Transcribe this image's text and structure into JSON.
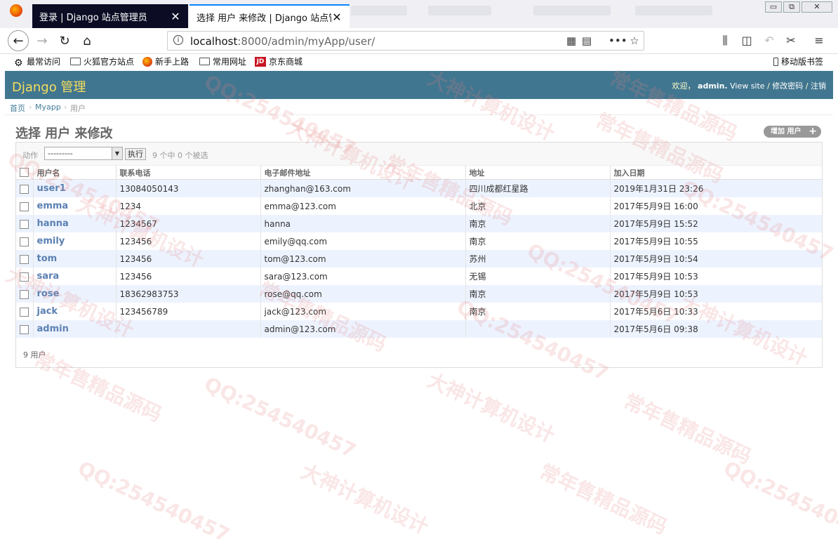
{
  "browser": {
    "tabs": [
      {
        "title": "登录 | Django 站点管理员",
        "close": "✕"
      },
      {
        "title": "选择 用户 来修改 | Django 站点管",
        "close": "✕"
      }
    ],
    "url_host": "localhost",
    "url_rest": ":8000/admin/myApp/user/",
    "bookmarks": [
      "最常访问",
      "火狐官方站点",
      "新手上路",
      "常用网址",
      "京东商城"
    ],
    "mobile_bookmarks": "移动版书签",
    "window_controls": [
      "▭",
      "⧉",
      "✕"
    ]
  },
  "header": {
    "brand": "Django 管理",
    "welcome": "欢迎，",
    "user": "admin.",
    "view_site": "View site",
    "sep": "/",
    "change_password": "修改密码",
    "logout": "注销"
  },
  "breadcrumbs": [
    "首页",
    "Myapp",
    "用户"
  ],
  "breadcrumb_sep": "›",
  "title": "选择 用户 来修改",
  "add_button": "增加 用户",
  "actions": {
    "label": "动作",
    "select_value": "---------",
    "go": "执行",
    "count": "9 个中 0 个被选"
  },
  "table": {
    "columns": [
      "用户名",
      "联系电话",
      "电子邮件地址",
      "地址",
      "加入日期"
    ],
    "rows": [
      [
        "user1",
        "13084050143",
        "zhanghan@163.com",
        "四川成都红星路",
        "2019年1月31日 23:26"
      ],
      [
        "emma",
        "1234",
        "emma@123.com",
        "北京",
        "2017年5月9日 16:00"
      ],
      [
        "hanna",
        "1234567",
        "hanna",
        "南京",
        "2017年5月9日 15:52"
      ],
      [
        "emily",
        "123456",
        "emily@qq.com",
        "南京",
        "2017年5月9日 10:55"
      ],
      [
        "tom",
        "123456",
        "tom@123.com",
        "苏州",
        "2017年5月9日 10:54"
      ],
      [
        "sara",
        "123456",
        "sara@123.com",
        "无锡",
        "2017年5月9日 10:53"
      ],
      [
        "rose",
        "18362983753",
        "rose@qq.com",
        "南京",
        "2017年5月9日 10:53"
      ],
      [
        "jack",
        "123456789",
        "jack@123.com",
        "南京",
        "2017年5月6日 10:33"
      ],
      [
        "admin",
        "",
        "admin@123.com",
        "",
        "2017年5月6日 09:38"
      ]
    ]
  },
  "paginator": "9 用户",
  "watermarks": [
    "QQ:254540457",
    "大神计算机设计",
    "常年售精品源码"
  ]
}
